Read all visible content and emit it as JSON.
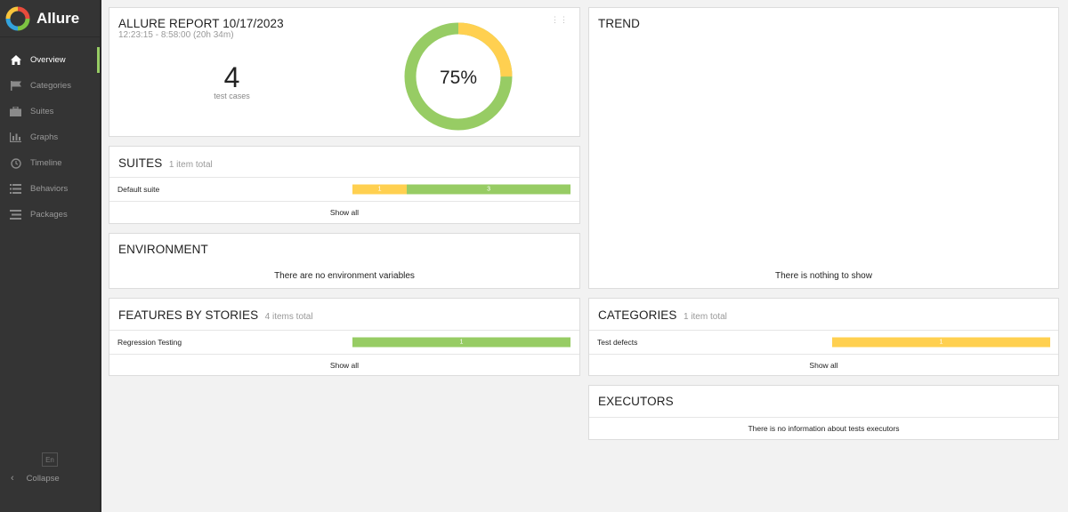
{
  "app": {
    "name": "Allure"
  },
  "sidebar": {
    "items": [
      {
        "label": "Overview",
        "icon": "home-icon",
        "active": true
      },
      {
        "label": "Categories",
        "icon": "flag-icon"
      },
      {
        "label": "Suites",
        "icon": "briefcase-icon"
      },
      {
        "label": "Graphs",
        "icon": "bar-chart-icon"
      },
      {
        "label": "Timeline",
        "icon": "clock-icon"
      },
      {
        "label": "Behaviors",
        "icon": "list-icon"
      },
      {
        "label": "Packages",
        "icon": "packages-icon"
      }
    ],
    "language": "En",
    "collapse_label": "Collapse"
  },
  "summary": {
    "title": "ALLURE REPORT 10/17/2023",
    "time_range": "12:23:15 - 8:58:00 (20h 34m)",
    "test_count": "4",
    "test_count_label": "test cases",
    "percent": "75%",
    "donut": {
      "passed": 3,
      "broken": 1
    }
  },
  "suites": {
    "title": "SUITES",
    "subtitle": "1 item total",
    "rows": [
      {
        "name": "Default suite",
        "broken": 1,
        "passed": 3,
        "broken_label": "1",
        "passed_label": "3"
      }
    ],
    "show_all": "Show all"
  },
  "environment": {
    "title": "ENVIRONMENT",
    "message": "There are no environment variables"
  },
  "features": {
    "title": "FEATURES BY STORIES",
    "subtitle": "4 items total",
    "rows": [
      {
        "name": "Regression Testing",
        "passed": 1,
        "passed_label": "1"
      }
    ],
    "show_all": "Show all"
  },
  "trend": {
    "title": "TREND",
    "message": "There is nothing to show"
  },
  "categories": {
    "title": "CATEGORIES",
    "subtitle": "1 item total",
    "rows": [
      {
        "name": "Test defects",
        "broken": 1,
        "broken_label": "1"
      }
    ],
    "show_all": "Show all"
  },
  "executors": {
    "title": "EXECUTORS",
    "message": "There is no information about tests executors"
  },
  "colors": {
    "passed": "#97cc64",
    "broken": "#ffd050",
    "sidebar": "#343434"
  }
}
